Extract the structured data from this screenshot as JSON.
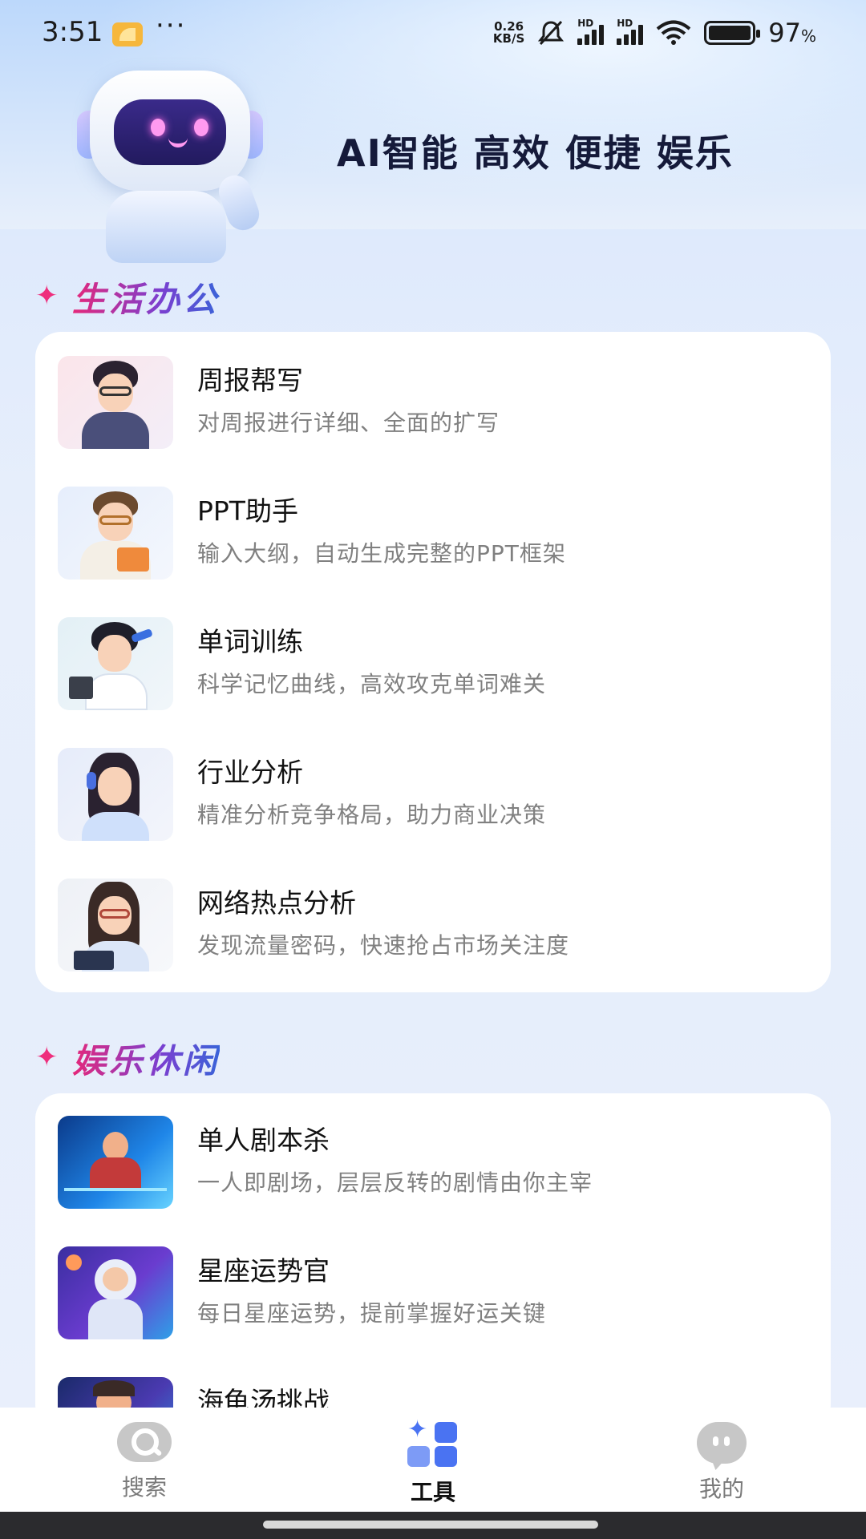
{
  "status_bar": {
    "time": "3:51",
    "more": "···",
    "net_speed_value": "0.26",
    "net_speed_unit": "KB/S",
    "signal_1_label": "HD",
    "signal_2_label": "HD",
    "battery_percent": "97",
    "battery_unit": "%",
    "icons": [
      "notification-app-icon",
      "mute-bell-icon",
      "signal-icon",
      "wifi-icon",
      "battery-icon"
    ]
  },
  "banner": {
    "slogan": "AI智能 高效 便捷 娱乐"
  },
  "sections": {
    "office": {
      "title": "生活办公",
      "items": [
        {
          "title": "周报帮写",
          "desc": "对周报进行详细、全面的扩写"
        },
        {
          "title": "PPT助手",
          "desc": "输入大纲，自动生成完整的PPT框架"
        },
        {
          "title": "单词训练",
          "desc": "科学记忆曲线，高效攻克单词难关"
        },
        {
          "title": "行业分析",
          "desc": "精准分析竞争格局，助力商业决策"
        },
        {
          "title": "网络热点分析",
          "desc": "发现流量密码，快速抢占市场关注度"
        }
      ]
    },
    "entertainment": {
      "title": "娱乐休闲",
      "items": [
        {
          "title": "单人剧本杀",
          "desc": "一人即剧场，层层反转的剧情由你主宰"
        },
        {
          "title": "星座运势官",
          "desc": "每日星座运势，提前掌握好运关键"
        },
        {
          "title": "海龟汤挑战",
          "desc": ""
        }
      ]
    }
  },
  "bottom_nav": {
    "items": [
      {
        "label": "搜索",
        "icon": "search-icon",
        "active": false
      },
      {
        "label": "工具",
        "icon": "tools-icon",
        "active": true
      },
      {
        "label": "我的",
        "icon": "profile-icon",
        "active": false
      }
    ]
  },
  "colors": {
    "accent_pink": "#ee2f7d",
    "accent_blue": "#4a73f2",
    "inactive_gray": "#c7c7c7"
  }
}
